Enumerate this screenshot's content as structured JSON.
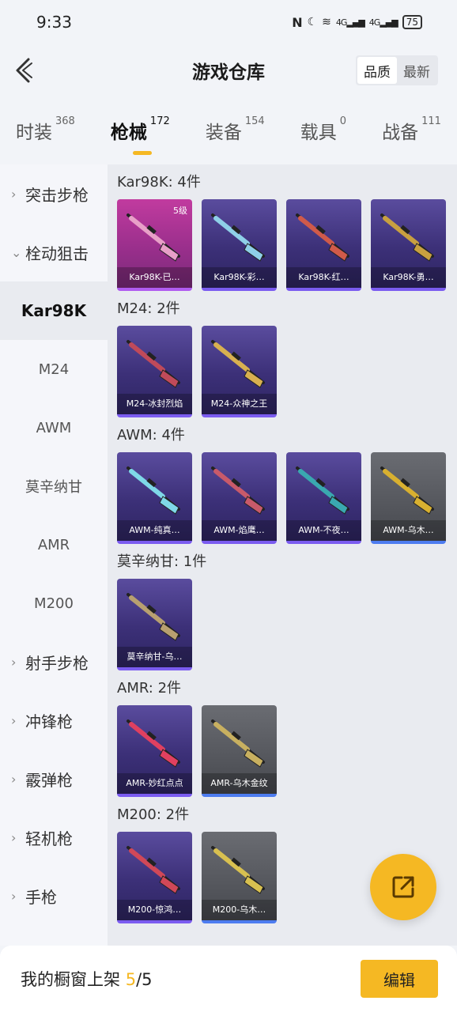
{
  "status": {
    "time": "9:33",
    "nfc": "N",
    "signal1": "4G",
    "signal2": "4G",
    "battery": "75"
  },
  "header": {
    "title": "游戏仓库",
    "sort": [
      "品质",
      "最新"
    ]
  },
  "tabs": [
    {
      "label": "时装",
      "count": "368"
    },
    {
      "label": "枪械",
      "count": "172"
    },
    {
      "label": "装备",
      "count": "154"
    },
    {
      "label": "载具",
      "count": "0"
    },
    {
      "label": "战备",
      "count": "111"
    }
  ],
  "sidebar": {
    "items": [
      {
        "label": "突击步枪",
        "chev": "›"
      },
      {
        "label": "栓动狙击",
        "chev": "⌄"
      },
      {
        "label": "Kar98K"
      },
      {
        "label": "M24"
      },
      {
        "label": "AWM"
      },
      {
        "label": "莫辛纳甘"
      },
      {
        "label": "AMR"
      },
      {
        "label": "M200"
      },
      {
        "label": "射手步枪",
        "chev": "›"
      },
      {
        "label": "冲锋枪",
        "chev": "›"
      },
      {
        "label": "霰弹枪",
        "chev": "›"
      },
      {
        "label": "轻机枪",
        "chev": "›"
      },
      {
        "label": "手枪",
        "chev": "›"
      }
    ]
  },
  "groups": [
    {
      "title": "Kar98K: 4件",
      "items": [
        {
          "name": "Kar98K-已…",
          "level": "5级",
          "style": "pink"
        },
        {
          "name": "Kar98K-彩…"
        },
        {
          "name": "Kar98K-红…"
        },
        {
          "name": "Kar98K-勇…"
        }
      ]
    },
    {
      "title": "M24: 2件",
      "items": [
        {
          "name": "M24-冰封烈焰"
        },
        {
          "name": "M24-众神之王"
        }
      ]
    },
    {
      "title": "AWM: 4件",
      "items": [
        {
          "name": "AWM-纯真…"
        },
        {
          "name": "AWM-焰鹰…"
        },
        {
          "name": "AWM-不夜…"
        },
        {
          "name": "AWM-乌木…",
          "style": "gray"
        }
      ]
    },
    {
      "title": "莫辛纳甘: 1件",
      "items": [
        {
          "name": "莫辛纳甘-乌…"
        }
      ]
    },
    {
      "title": "AMR: 2件",
      "items": [
        {
          "name": "AMR-妙红点点"
        },
        {
          "name": "AMR-乌木金纹",
          "style": "gray"
        }
      ]
    },
    {
      "title": "M200: 2件",
      "items": [
        {
          "name": "M200-惊鸿…"
        },
        {
          "name": "M200-乌木…",
          "style": "gray"
        }
      ]
    }
  ],
  "bottom": {
    "label": "我的橱窗上架 ",
    "count": "5",
    "total": "/5",
    "edit_label": "编辑"
  },
  "colors": {
    "accent": "#f5b823",
    "card_purple": "#3c3078",
    "card_pink": "#9a2f8c",
    "card_gray": "#55575d"
  }
}
